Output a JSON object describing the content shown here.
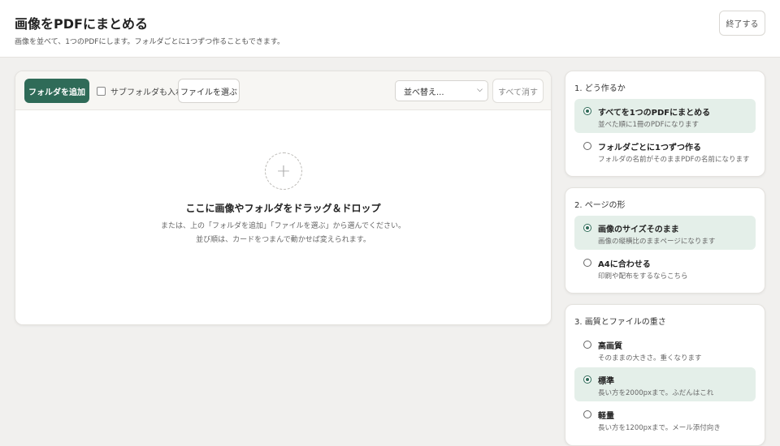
{
  "header": {
    "title": "画像をPDFにまとめる",
    "subtitle": "画像を並べて、1つのPDFにします。フォルダごとに1つずつ作ることもできます。",
    "quit_label": "終了する"
  },
  "toolbar": {
    "add_folder_label": "フォルダを追加",
    "subfolder_label": "サブフォルダも入れる",
    "choose_file_label": "ファイルを選ぶ",
    "sort_placeholder": "並べ替え...",
    "clear_all_label": "すべて消す"
  },
  "dropzone": {
    "title": "ここに画像やフォルダをドラッグ＆ドロップ",
    "line1": "または、上の「フォルダを追加」「ファイルを選ぶ」から選んでください。",
    "line2": "並び順は、カードをつまんで動かせば変えられます。"
  },
  "cards": [
    {
      "title": "1. どう作るか",
      "options": [
        {
          "label": "すべてを1つのPDFにまとめる",
          "desc": "並べた順に1冊のPDFになります",
          "selected": true
        },
        {
          "label": "フォルダごとに1つずつ作る",
          "desc": "フォルダの名前がそのままPDFの名前になります",
          "selected": false
        }
      ]
    },
    {
      "title": "2. ページの形",
      "options": [
        {
          "label": "画像のサイズそのまま",
          "desc": "画像の縦横比のままページになります",
          "selected": true
        },
        {
          "label": "A4に合わせる",
          "desc": "印刷や配布をするならこちら",
          "selected": false
        }
      ]
    },
    {
      "title": "3. 画質とファイルの重さ",
      "options": [
        {
          "label": "高画質",
          "desc": "そのままの大きさ。重くなります",
          "selected": false
        },
        {
          "label": "標準",
          "desc": "長い方を2000pxまで。ふだんはこれ",
          "selected": true
        },
        {
          "label": "軽量",
          "desc": "長い方を1200pxまで。メール添付向き",
          "selected": false
        }
      ]
    }
  ],
  "colors": {
    "accent": "#2f6b58",
    "selected_bg": "#e4efe9"
  }
}
